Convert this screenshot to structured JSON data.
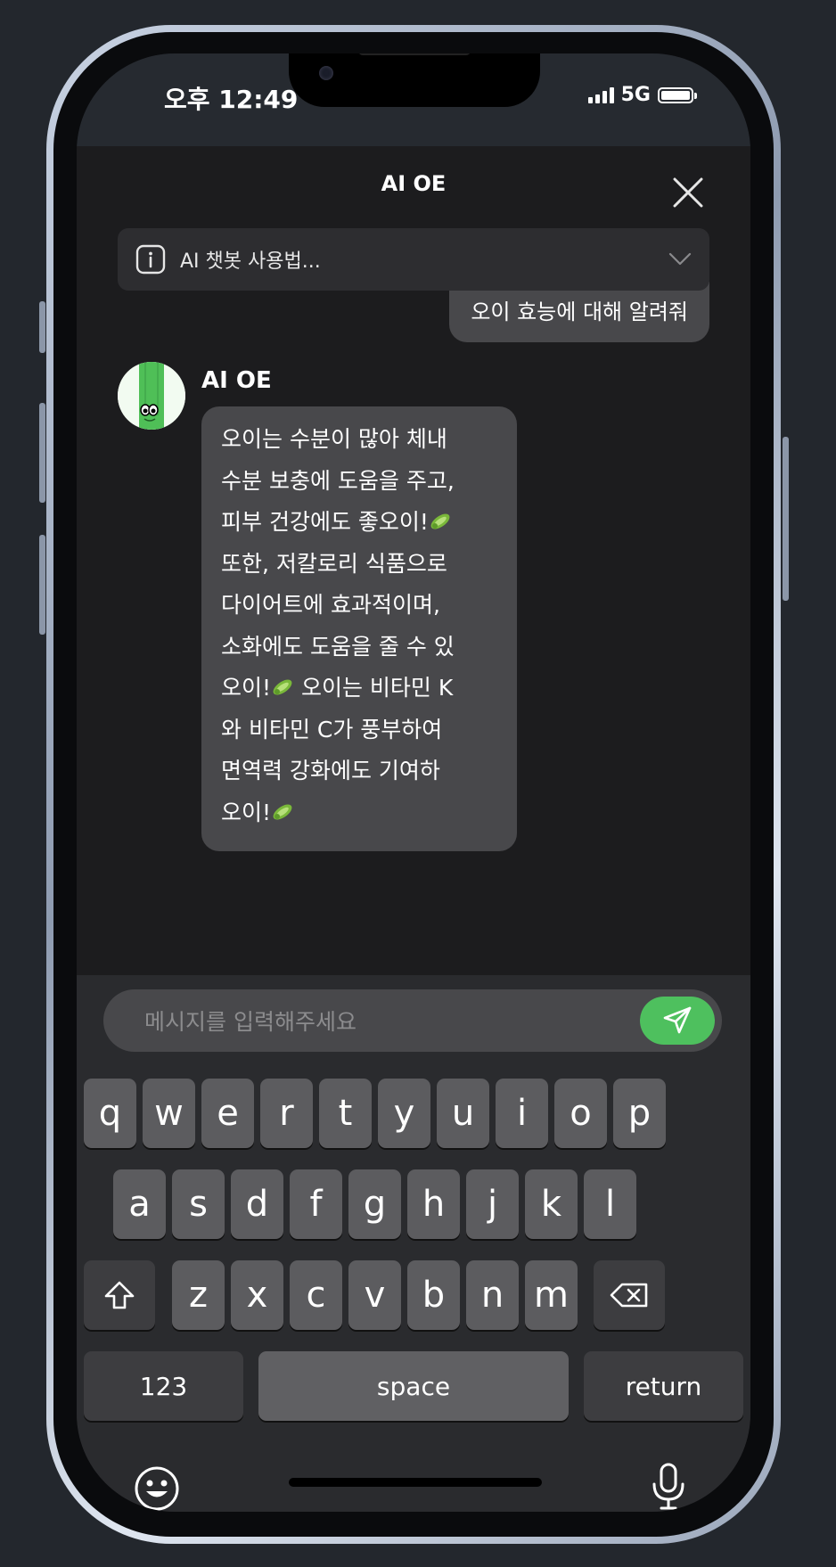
{
  "status_bar": {
    "time": "오후 12:49",
    "network": "5G"
  },
  "header": {
    "title": "AI OE"
  },
  "info_bar": {
    "text": "AI 챗봇 사용법..."
  },
  "messages": {
    "user": "오이 효능에 대해 알려줘",
    "bot_name": "AI OE",
    "bot_lines": [
      "오이는 수분이 많아 체내",
      "수분 보충에 도움을 주고,",
      "피부 건강에도 좋오이!",
      "또한, 저칼로리 식품으로",
      "다이어트에 효과적이며,",
      "소화에도 도움을 줄 수 있",
      "오이!",
      "오이는 비타민 K",
      "와 비타민 C가 풍부하여",
      "면역력 강화에도 기여하",
      "오이!"
    ]
  },
  "input": {
    "placeholder": "메시지를 입력해주세요"
  },
  "keyboard": {
    "row1": [
      "q",
      "w",
      "e",
      "r",
      "t",
      "y",
      "u",
      "i",
      "o",
      "p"
    ],
    "row2": [
      "a",
      "s",
      "d",
      "f",
      "g",
      "h",
      "j",
      "k",
      "l"
    ],
    "row3": [
      "z",
      "x",
      "c",
      "v",
      "b",
      "n",
      "m"
    ],
    "numbers_label": "123",
    "space_label": "space",
    "return_label": "return"
  },
  "colors": {
    "accent": "#4ec05e",
    "bubble": "#48484b",
    "background": "#1c1c1e"
  }
}
